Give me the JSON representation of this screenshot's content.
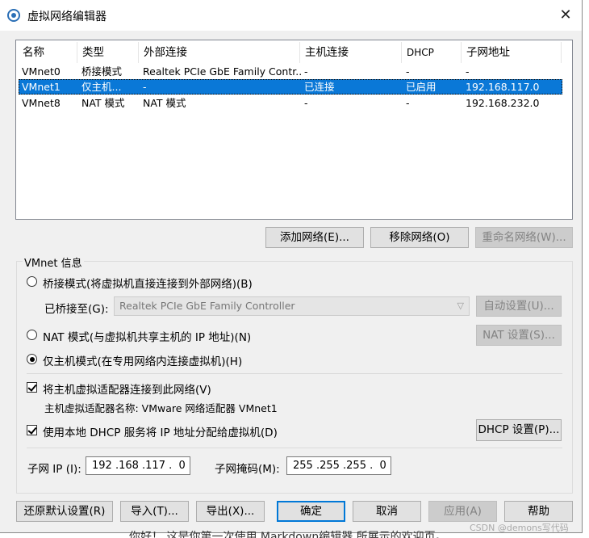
{
  "window": {
    "title": "虚拟网络编辑器",
    "close_glyph": "✕"
  },
  "table": {
    "headers": [
      "名称",
      "类型",
      "外部连接",
      "主机连接",
      "DHCP",
      "子网地址"
    ],
    "rows": [
      {
        "name": "VMnet0",
        "type": "桥接模式",
        "external": "Realtek PCIe GbE Family Contr...",
        "host": "-",
        "dhcp": "-",
        "subnet": "-",
        "selected": false
      },
      {
        "name": "VMnet1",
        "type": "仅主机...",
        "external": "-",
        "host": "已连接",
        "dhcp": "已启用",
        "subnet": "192.168.117.0",
        "selected": true
      },
      {
        "name": "VMnet8",
        "type": "NAT 模式",
        "external": "NAT 模式",
        "host": "-",
        "dhcp": "-",
        "subnet": "192.168.232.0",
        "selected": false
      }
    ]
  },
  "buttons": {
    "add": "添加网络(E)...",
    "remove": "移除网络(O)",
    "rename": "重命名网络(W)..."
  },
  "info": {
    "label": "VMnet 信息",
    "bridge_radio": "桥接模式(将虚拟机直接连接到外部网络)(B)",
    "bridged_to_label": "已桥接至(G):",
    "bridged_to_value": "Realtek PCIe GbE Family Controller",
    "auto_settings": "自动设置(U)...",
    "nat_radio": "NAT 模式(与虚拟机共享主机的 IP 地址)(N)",
    "nat_settings": "NAT 设置(S)...",
    "hostonly_radio": "仅主机模式(在专用网络内连接虚拟机)(H)",
    "connect_adapter": "将主机虚拟适配器连接到此网络(V)",
    "adapter_name": "主机虚拟适配器名称: VMware 网络适配器 VMnet1",
    "use_dhcp": "使用本地 DHCP 服务将 IP 地址分配给虚拟机(D)",
    "dhcp_settings": "DHCP 设置(P)...",
    "subnet_ip_label": "子网 IP (I):",
    "subnet_ip_value": "192 .168 .117 .  0",
    "subnet_mask_label": "子网掩码(M):",
    "subnet_mask_value": "255 .255 .255 .  0"
  },
  "footer": {
    "restore": "还原默认设置(R)",
    "import": "导入(T)...",
    "export": "导出(X)...",
    "ok": "确定",
    "cancel": "取消",
    "apply": "应用(A)",
    "help": "帮助"
  },
  "background": {
    "watermark": "CSDN @demons写代码",
    "behind_text": "你好！ 这是你第一次使用 Markdown编辑器 所展示的欢迎页。"
  },
  "colors": {
    "selection": "#0a78d7",
    "default_button_border": "#0078d7",
    "dialog_bg": "#f0f0f0"
  }
}
